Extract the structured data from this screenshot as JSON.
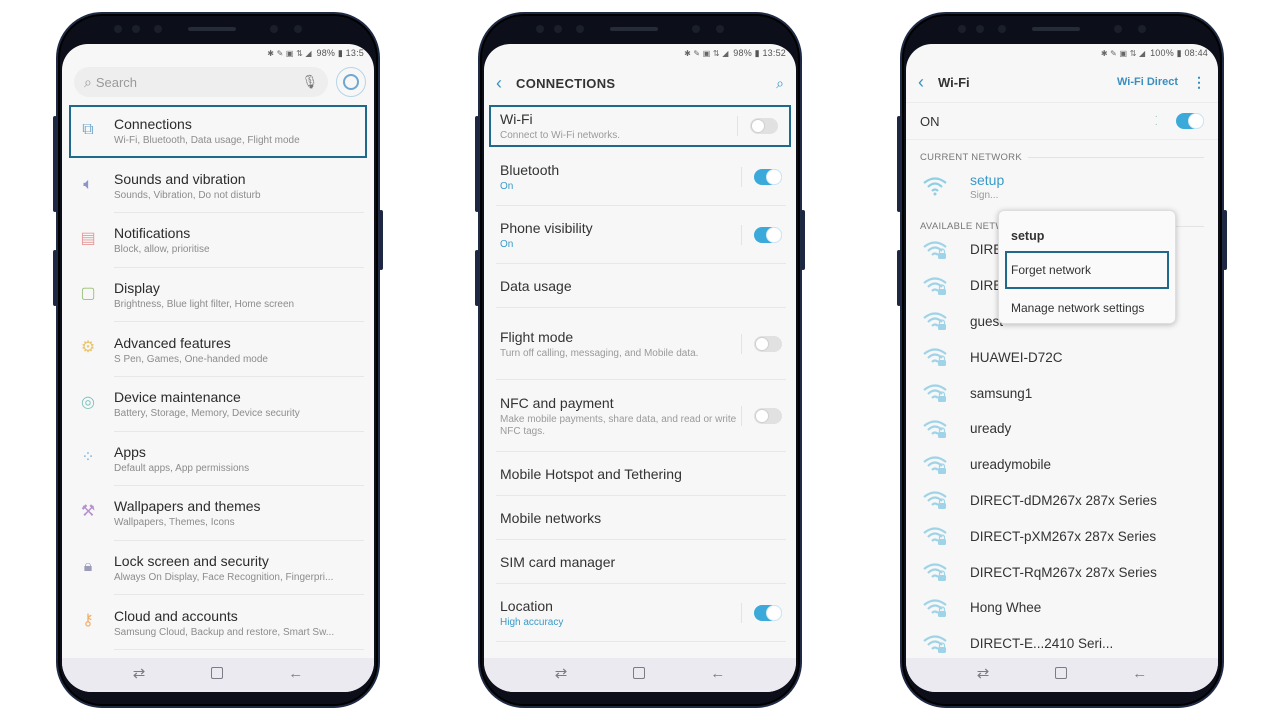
{
  "colors": {
    "accent": "#3a9ac9",
    "highlight_border": "#1f6a8c",
    "toggle_on": "#3ba9d9",
    "toggle_off": "#e1e1e1",
    "screen_bg": "#f7f7f7",
    "phone_frame": "#0c0f1a"
  },
  "phones": [
    {
      "status": {
        "icons": "bluetooth nfc sync wifi signal",
        "battery": "98%",
        "time": "13:5"
      },
      "search": {
        "placeholder": "Search",
        "search_icon": "search-icon",
        "mic_icon": "mic-icon",
        "account_icon": "account-icon"
      },
      "items": [
        {
          "title": "Connections",
          "subtitle": "Wi-Fi, Bluetooth, Data usage, Flight mode",
          "icon": "connections-icon",
          "icon_color": "#6fa7cf",
          "highlighted": true
        },
        {
          "title": "Sounds and vibration",
          "subtitle": "Sounds, Vibration, Do not disturb",
          "icon": "speaker-icon",
          "icon_color": "#8b95c9"
        },
        {
          "title": "Notifications",
          "subtitle": "Block, allow, prioritise",
          "icon": "notifications-icon",
          "icon_color": "#e89a9a"
        },
        {
          "title": "Display",
          "subtitle": "Brightness, Blue light filter, Home screen",
          "icon": "display-icon",
          "icon_color": "#9cc07a"
        },
        {
          "title": "Advanced features",
          "subtitle": "S Pen, Games, One-handed mode",
          "icon": "gear-plus-icon",
          "icon_color": "#e8c56e"
        },
        {
          "title": "Device maintenance",
          "subtitle": "Battery, Storage, Memory, Device security",
          "icon": "maintenance-icon",
          "icon_color": "#7fc4c0"
        },
        {
          "title": "Apps",
          "subtitle": "Default apps, App permissions",
          "icon": "apps-icon",
          "icon_color": "#7fb3da"
        },
        {
          "title": "Wallpapers and themes",
          "subtitle": "Wallpapers, Themes, Icons",
          "icon": "brush-icon",
          "icon_color": "#b592cf"
        },
        {
          "title": "Lock screen and security",
          "subtitle": "Always On Display, Face Recognition, Fingerpri...",
          "icon": "lock-icon",
          "icon_color": "#9c9cb8"
        },
        {
          "title": "Cloud and accounts",
          "subtitle": "Samsung Cloud, Backup and restore, Smart Sw...",
          "icon": "key-icon",
          "icon_color": "#f0b06b"
        }
      ]
    },
    {
      "status": {
        "icons": "bluetooth nfc sync wifi signal",
        "battery": "98%",
        "time": "13:52"
      },
      "header": {
        "title": "CONNECTIONS",
        "back_icon": "back-icon",
        "search_icon": "search-icon"
      },
      "items": [
        {
          "title": "Wi-Fi",
          "subtitle": "Connect to Wi-Fi networks.",
          "toggle": "off",
          "highlighted": true
        },
        {
          "title": "Bluetooth",
          "subtitle": "On",
          "subtitle_on": true,
          "toggle": "on"
        },
        {
          "title": "Phone visibility",
          "subtitle": "On",
          "subtitle_on": true,
          "toggle": "on"
        },
        {
          "title": "Data usage"
        },
        {
          "title": "Flight mode",
          "subtitle": "Turn off calling, messaging, and Mobile data.",
          "toggle": "off"
        },
        {
          "title": "NFC and payment",
          "subtitle": "Make mobile payments, share data, and read or write NFC tags.",
          "toggle": "off"
        },
        {
          "title": "Mobile Hotspot and Tethering"
        },
        {
          "title": "Mobile networks"
        },
        {
          "title": "SIM card manager"
        },
        {
          "title": "Location",
          "subtitle": "High accuracy",
          "subtitle_on": true,
          "toggle": "on"
        }
      ]
    },
    {
      "status": {
        "icons": "bluetooth nfc sync wifi signal",
        "battery": "100%",
        "time": "08:44"
      },
      "header": {
        "title": "Wi-Fi",
        "action": "Wi-Fi Direct",
        "back_icon": "back-icon",
        "more_icon": "more-vert-icon"
      },
      "master": {
        "label": "ON",
        "toggle": "on"
      },
      "current_label": "CURRENT NETWORK",
      "current": {
        "name": "setup",
        "subtitle": "Sign..."
      },
      "available_label": "AVAILABLE NETWORKS",
      "networks": [
        "DIRECT-...",
        "DIRECT-...ms..",
        "guest",
        "HUAWEI-D72C",
        "samsung1",
        "uready",
        "ureadymobile",
        "DIRECT-dDM267x 287x Series",
        "DIRECT-pXM267x 287x Series",
        "DIRECT-RqM267x 287x Series",
        "Hong Whee",
        "DIRECT-E...2410 Seri..."
      ],
      "popup": {
        "title": "setup",
        "options": [
          "Forget network",
          "Manage network settings"
        ],
        "highlighted_option": 0
      }
    }
  ],
  "navbar": {
    "recent": "⇄",
    "home": "home",
    "back": "←"
  }
}
